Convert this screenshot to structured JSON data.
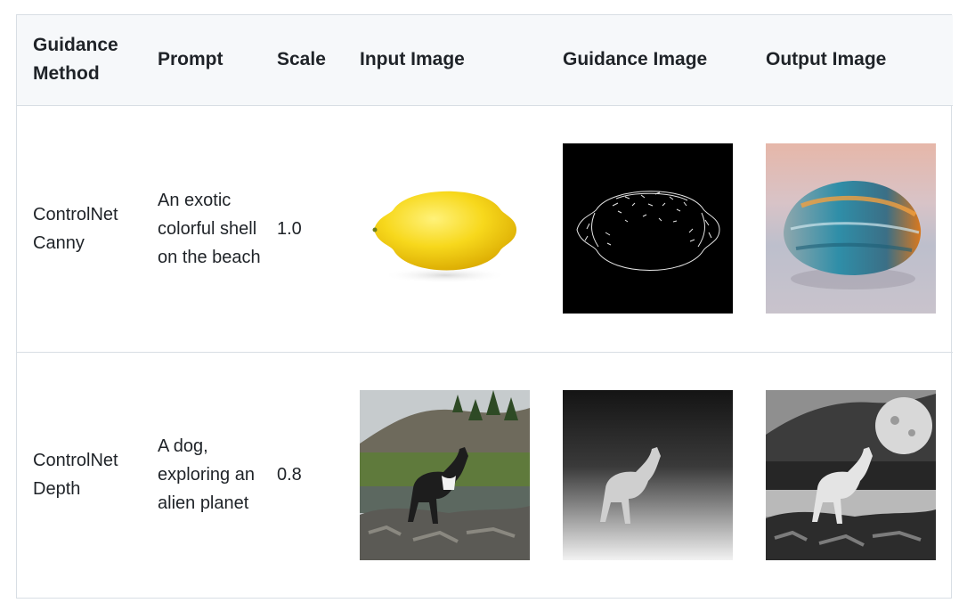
{
  "table": {
    "headers": {
      "method": "Guidance Method",
      "prompt": "Prompt",
      "scale": "Scale",
      "input": "Input Image",
      "guidance": "Guidance Image",
      "output": "Output Image"
    },
    "rows": [
      {
        "method": "ControlNet Canny",
        "prompt": "An exotic colorful shell on the beach",
        "scale": "1.0",
        "input_image": "lemon photo",
        "guidance_image": "canny edge map of lemon",
        "output_image": "colorful shell on beach"
      },
      {
        "method": "ControlNet Depth",
        "prompt": "A dog, exploring an alien planet",
        "scale": "0.8",
        "input_image": "dog on rocks by river",
        "guidance_image": "depth map of dog",
        "output_image": "monochrome dog on alien planet"
      }
    ]
  }
}
